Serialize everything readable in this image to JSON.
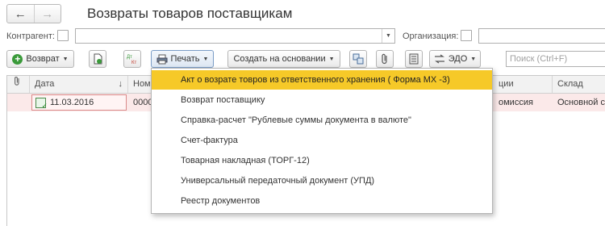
{
  "window": {
    "title": "Возвраты товаров поставщикам"
  },
  "nav": {
    "back": "←",
    "forward": "→"
  },
  "filters": {
    "counterparty_label": "Контрагент:",
    "counterparty_value": "",
    "organization_label": "Организация:",
    "organization_value": ""
  },
  "toolbar": {
    "return_label": "Возврат",
    "print_label": "Печать",
    "create_based_label": "Создать на основании",
    "edo_label": "ЭДО",
    "search_placeholder": "Поиск (Ctrl+F)"
  },
  "table": {
    "columns": [
      "Дата",
      "Ном",
      "ции",
      "Склад"
    ],
    "sort_indicator": "↓",
    "rows": [
      {
        "date": "11.03.2016",
        "number": "0000",
        "operation": "омиссия",
        "warehouse": "Основной с"
      }
    ]
  },
  "print_menu": {
    "items": [
      "Акт о возрате товров из ответственного хранения ( Форма МХ -3)",
      "Возврат поставщику",
      "Справка-расчет \"Рублевые суммы документа в валюте\"",
      "Счет-фактура",
      "Товарная накладная (ТОРГ-12)",
      "Универсальный передаточный документ (УПД)",
      "Реестр документов"
    ],
    "highlighted_index": 0
  },
  "colors": {
    "highlight": "#f6c928",
    "row_selected": "#fbe9e9",
    "accent_green": "#3a9a3a"
  }
}
